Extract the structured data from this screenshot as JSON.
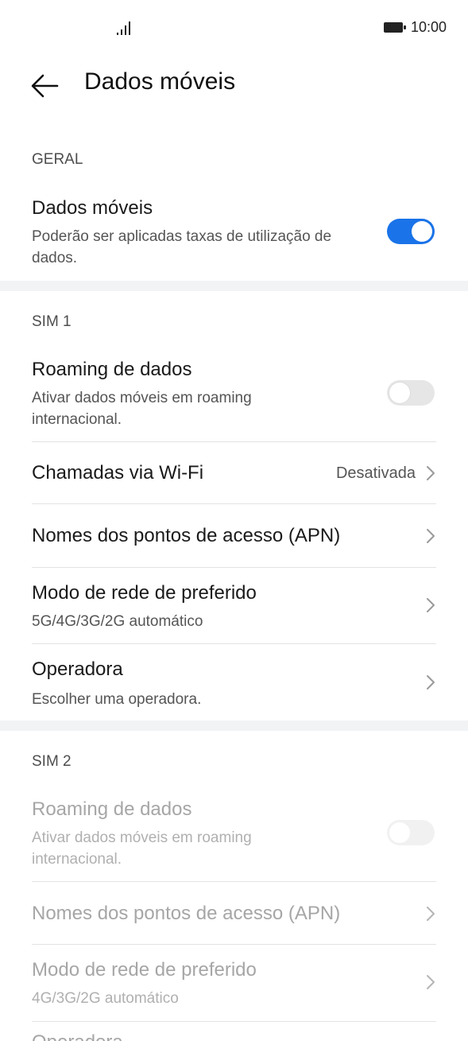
{
  "status_bar": {
    "time": "10:00"
  },
  "app_bar": {
    "title": "Dados móveis"
  },
  "general": {
    "header": "GERAL",
    "mobile_data": {
      "title": "Dados móveis",
      "subtitle": "Poderão ser aplicadas taxas de utilização de dados.",
      "enabled": true
    }
  },
  "sim1": {
    "header": "SIM 1",
    "roaming": {
      "title": "Roaming de dados",
      "subtitle": "Ativar dados móveis em roaming internacional.",
      "enabled": false
    },
    "wifi_calling": {
      "title": "Chamadas via Wi-Fi",
      "value": "Desativada"
    },
    "apn": {
      "title": "Nomes dos pontos de acesso (APN)"
    },
    "network_mode": {
      "title": "Modo de rede de preferido",
      "subtitle": "5G/4G/3G/2G automático"
    },
    "carrier": {
      "title": "Operadora",
      "subtitle": "Escolher uma operadora."
    }
  },
  "sim2": {
    "header": "SIM 2",
    "roaming": {
      "title": "Roaming de dados",
      "subtitle": "Ativar dados móveis em roaming internacional.",
      "enabled": false
    },
    "apn": {
      "title": "Nomes dos pontos de acesso (APN)"
    },
    "network_mode": {
      "title": "Modo de rede de preferido",
      "subtitle": "4G/3G/2G automático"
    },
    "carrier": {
      "title": "Operadora"
    }
  },
  "colors": {
    "accent": "#1a73e8",
    "band": "#f1f3f5"
  }
}
